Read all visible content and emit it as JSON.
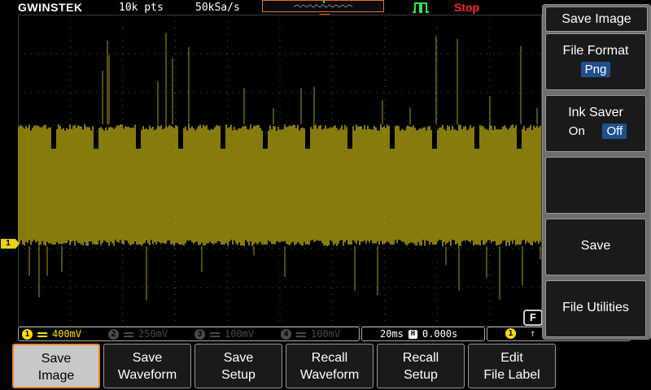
{
  "header": {
    "brand": "GWINSTEK",
    "record_length": "10k pts",
    "sample_rate": "50kSa/s",
    "run_state": "Stop"
  },
  "channel_marker": "1",
  "f_badge": "F",
  "channels": [
    {
      "num": "1",
      "scale": "400mV",
      "active": true
    },
    {
      "num": "2",
      "scale": "250mV",
      "active": false
    },
    {
      "num": "3",
      "scale": "100mV",
      "active": false
    },
    {
      "num": "4",
      "scale": "100mV",
      "active": false
    }
  ],
  "timebase": {
    "scale": "20ms",
    "position_icon": "H",
    "position": "0.000s"
  },
  "trigger": {
    "source": "1",
    "edge_icon": "rising-edge-icon"
  },
  "side_menu": {
    "title": "Save Image",
    "file_format_label": "File Format",
    "file_format_value": "Png",
    "ink_saver_label": "Ink Saver",
    "ink_saver_on": "On",
    "ink_saver_off": "Off",
    "ink_saver_selected": "Off",
    "save_label": "Save",
    "file_utilities_label": "File Utilities"
  },
  "bottom_menu": [
    {
      "line1": "Save",
      "line2": "Image",
      "active": true
    },
    {
      "line1": "Save",
      "line2": "Waveform",
      "active": false
    },
    {
      "line1": "Save",
      "line2": "Setup",
      "active": false
    },
    {
      "line1": "Recall",
      "line2": "Waveform",
      "active": false
    },
    {
      "line1": "Recall",
      "line2": "Setup",
      "active": false
    },
    {
      "line1": "Edit",
      "line2": "File Label",
      "active": false
    }
  ],
  "colors": {
    "ch1": "#ffe000",
    "trace": "#a89a10",
    "grid": "#5a5a5a",
    "menu_highlight": "#1f4f8e",
    "run_state": "#ff2a2a"
  }
}
